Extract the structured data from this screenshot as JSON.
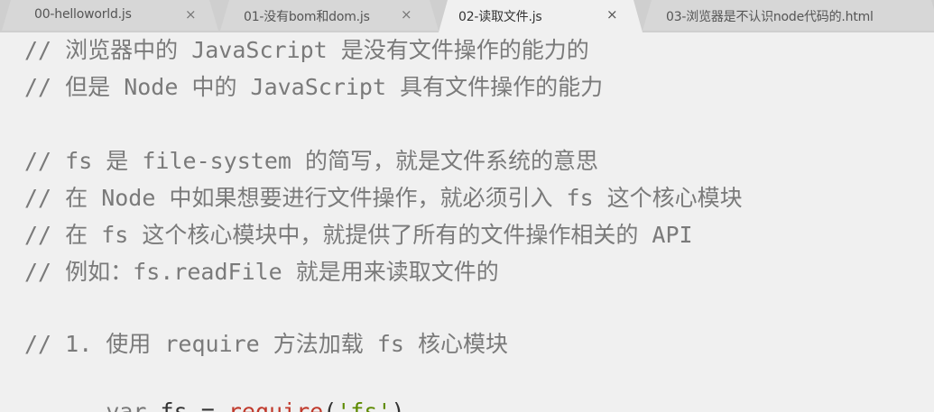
{
  "tabs": [
    {
      "label": "00-helloworld.js",
      "close": "×",
      "active": false
    },
    {
      "label": "01-没有bom和dom.js",
      "close": "×",
      "active": false
    },
    {
      "label": "02-读取文件.js",
      "close": "×",
      "active": true
    },
    {
      "label": "03-浏览器是不认识node代码的.html",
      "close": "",
      "active": false
    }
  ],
  "code": {
    "comments": [
      "// 浏览器中的 JavaScript 是没有文件操作的能力的",
      "// 但是 Node 中的 JavaScript 具有文件操作的能力",
      "// fs 是 file-system 的简写，就是文件系统的意思",
      "// 在 Node 中如果想要进行文件操作，就必须引入 fs 这个核心模块",
      "// 在 fs 这个核心模块中，就提供了所有的文件操作相关的 API",
      "// 例如：fs.readFile 就是用来读取文件的",
      "// 1. 使用 require 方法加载 fs 核心模块"
    ],
    "statement": {
      "keyword": "var",
      "identifier": "fs",
      "operator": "=",
      "function": "require",
      "open_paren": "(",
      "argument": "'fs'",
      "close_paren": ")"
    }
  },
  "colors": {
    "comment": "#7a7a7a",
    "function": "#c0392b",
    "string": "#5d8a00",
    "text": "#333333",
    "background": "#f0f0f0"
  }
}
